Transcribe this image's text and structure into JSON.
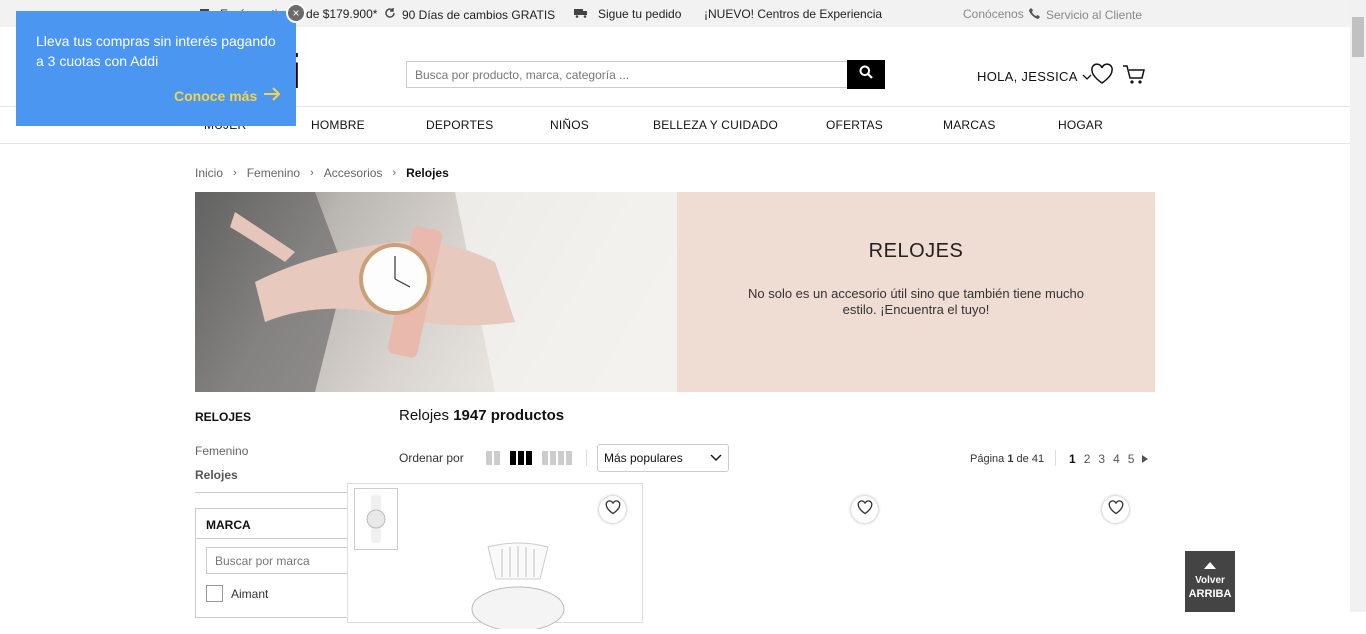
{
  "topbar": {
    "shipping": "Envío gratis desde $179.900*",
    "returns": "90 Días de cambios GRATIS",
    "tracking": "Sigue tu pedido",
    "experience": "¡NUEVO! Centros de Experiencia",
    "about": "Conócenos",
    "service": "Servicio al Cliente"
  },
  "header": {
    "logo": "ti",
    "search_placeholder": "Busca por producto, marca, categoría ...",
    "greeting": "HOLA, JESSICA"
  },
  "nav": {
    "items": [
      "MUJER",
      "HOMBRE",
      "DEPORTES",
      "NIÑOS",
      "BELLEZA Y CUIDADO",
      "OFERTAS",
      "MARCAS",
      "HOGAR"
    ]
  },
  "breadcrumb": [
    "Inicio",
    "Femenino",
    "Accesorios",
    "Relojes"
  ],
  "banner": {
    "title": "RELOJES",
    "description": "No solo es un accesorio útil sino que también tiene mucho estilo. ¡Encuentra el tuyo!"
  },
  "sidebar": {
    "title": "RELOJES",
    "links": [
      "Femenino",
      "Relojes"
    ],
    "filter": {
      "title": "MARCA",
      "search_placeholder": "Buscar por marca",
      "options": [
        "Aimant"
      ]
    }
  },
  "results": {
    "category": "Relojes",
    "count": "1947 productos",
    "sort_label": "Ordenar por",
    "sort_value": "Más populares",
    "page_label": "Página",
    "page_current": "1",
    "page_of": "de",
    "page_total": "41",
    "pages": [
      "1",
      "2",
      "3",
      "4",
      "5"
    ]
  },
  "back_to_top": {
    "line1": "Volver",
    "line2": "ARRIBA"
  },
  "popup": {
    "text": "Lleva tus compras sin interés pagando a 3 cuotas con Addi",
    "link": "Conoce más",
    "close": "×"
  },
  "colors": {
    "popup_bg": "#4b96f0",
    "popup_link": "#f5d547",
    "banner_bg": "#efdcd3"
  }
}
